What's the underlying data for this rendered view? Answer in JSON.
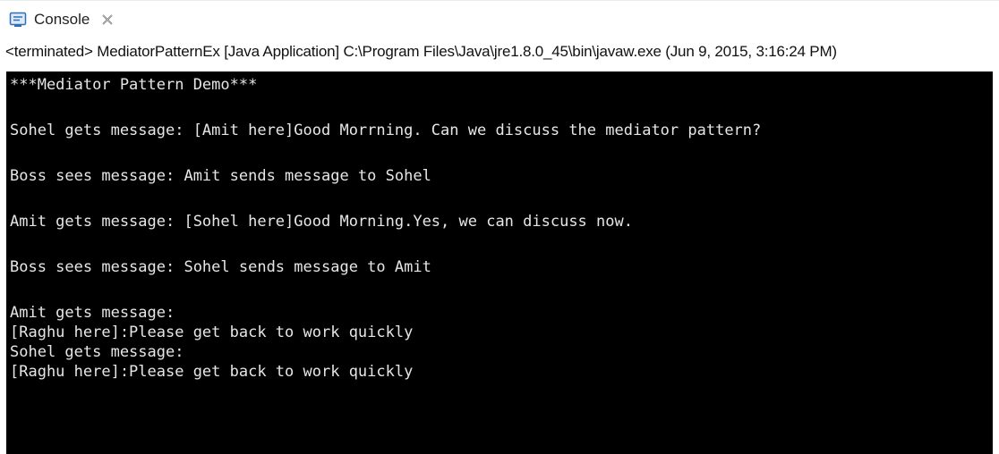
{
  "tab": {
    "icon": "console-icon",
    "label": "Console",
    "close_icon": "close-icon"
  },
  "status_line": "<terminated> MediatorPatternEx [Java Application] C:\\Program Files\\Java\\jre1.8.0_45\\bin\\javaw.exe (Jun 9, 2015, 3:16:24 PM)",
  "terminal": {
    "lines": [
      "***Mediator Pattern Demo***",
      "",
      "Sohel gets message: [Amit here]Good Morrning. Can we discuss the mediator pattern?",
      "",
      "Boss sees message: Amit sends message to Sohel",
      "",
      "Amit gets message: [Sohel here]Good Morning.Yes, we can discuss now.",
      "",
      "Boss sees message: Sohel sends message to Amit",
      "",
      "Amit gets message:",
      "[Raghu here]:Please get back to work quickly",
      "Sohel gets message:",
      "[Raghu here]:Please get back to work quickly"
    ]
  },
  "colors": {
    "terminal_bg": "#000000",
    "terminal_fg": "#e6e6e6",
    "icon_accent": "#2f6fb3"
  }
}
